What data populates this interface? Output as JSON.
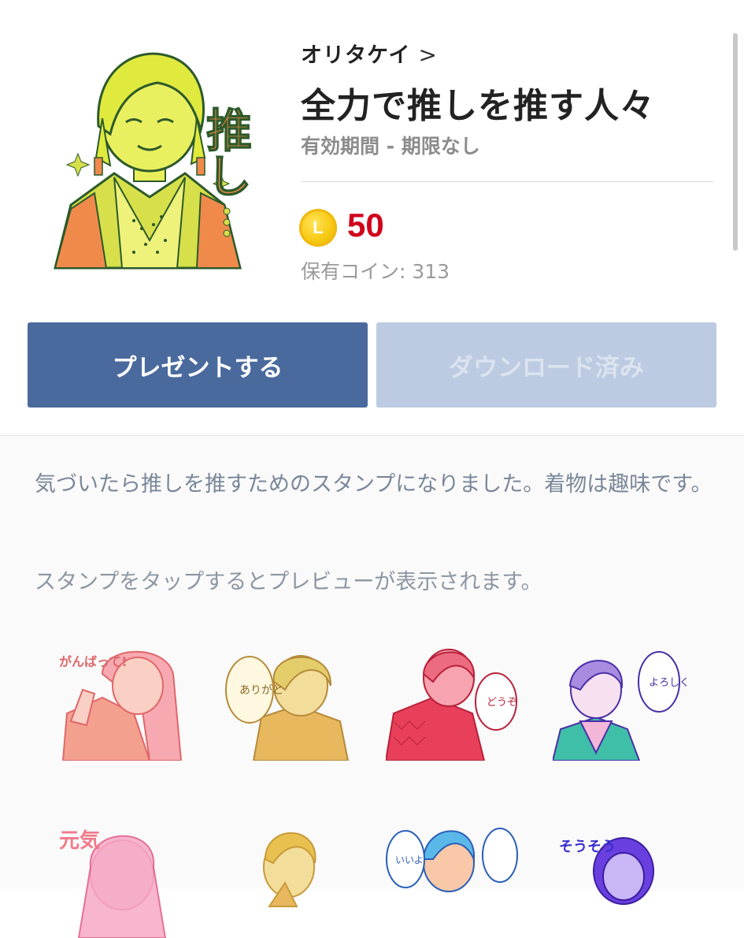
{
  "product": {
    "author": "オリタケイ",
    "author_chevron": ">",
    "title": "全力で推しを推す人々",
    "validity": "有効期間 - 期限なし",
    "price": "50",
    "coin_letter": "L",
    "owned_coins": "保有コイン: 313"
  },
  "actions": {
    "present_label": "プレゼントする",
    "download_label": "ダウンロード済み"
  },
  "description": "気づいたら推しを推すためのスタンプになりました。着物は趣味です。",
  "preview_hint": "スタンプをタップするとプレビューが表示されます。",
  "thumbnail": {
    "kanji_oshi": "推し"
  },
  "stickers": [
    {
      "label": "sticker-1",
      "bubble": "がんばって!"
    },
    {
      "label": "sticker-2",
      "bubble": "ありがと"
    },
    {
      "label": "sticker-3",
      "bubble": "どうぞ"
    },
    {
      "label": "sticker-4",
      "bubble": "よろしく"
    },
    {
      "label": "sticker-5",
      "bubble": "元気"
    },
    {
      "label": "sticker-6",
      "bubble": ""
    },
    {
      "label": "sticker-7",
      "bubble": "いいよ"
    },
    {
      "label": "sticker-8",
      "bubble": "そうそう"
    }
  ],
  "colors": {
    "present_button": "#4a6a9e",
    "download_button_disabled": "#bccbe1",
    "price": "#d0021b",
    "coin": "#f7c811"
  }
}
